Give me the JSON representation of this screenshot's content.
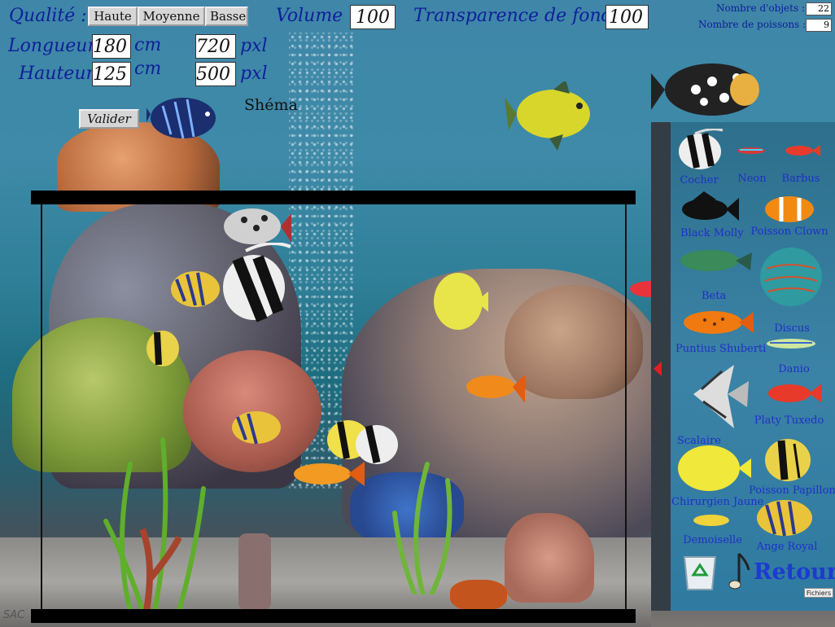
{
  "top": {
    "quality_label": "Qualité :",
    "quality_options": [
      "Haute",
      "Moyenne",
      "Basse"
    ],
    "volume_label": "Volume :",
    "volume_value": "100",
    "transparency_label": "Transparence de fond :",
    "transparency_value": "100",
    "length_label": "Longueur",
    "length_cm": "180",
    "length_unit": "cm",
    "length_px": "720",
    "height_label": "Hauteur",
    "height_cm": "125",
    "height_unit": "cm",
    "height_px": "500",
    "px_unit": "pxl",
    "validate_button": "Valider",
    "schema_label": "Shéma"
  },
  "stats": {
    "objects_label": "Nombre d'objets :",
    "objects_value": "22",
    "fish_label": "Nombre de poissons :",
    "fish_value": "9"
  },
  "palette": {
    "fish": [
      {
        "name": "Cocher",
        "icon": "cocher-fish-icon"
      },
      {
        "name": "Neon",
        "icon": "neon-fish-icon"
      },
      {
        "name": "Barbus",
        "icon": "barbus-fish-icon"
      },
      {
        "name": "Black Molly",
        "icon": "black-molly-fish-icon"
      },
      {
        "name": "Poisson Clown",
        "icon": "clownfish-icon"
      },
      {
        "name": "Beta",
        "icon": "beta-fish-icon"
      },
      {
        "name": "Discus",
        "icon": "discus-fish-icon"
      },
      {
        "name": "Puntius Shuberti",
        "icon": "puntius-fish-icon"
      },
      {
        "name": "Danio",
        "icon": "danio-fish-icon"
      },
      {
        "name": "Scalaire",
        "icon": "scalaire-fish-icon"
      },
      {
        "name": "Platy Tuxedo",
        "icon": "platy-fish-icon"
      },
      {
        "name": "Chirurgien Jaune",
        "icon": "yellow-tang-icon"
      },
      {
        "name": "Poisson Papillon",
        "icon": "butterflyfish-icon"
      },
      {
        "name": "Demoiselle",
        "icon": "demoiselle-fish-icon"
      },
      {
        "name": "Ange Royal",
        "icon": "royal-angelfish-icon"
      }
    ],
    "trash_icon": "recycle-bin-icon",
    "music_icon": "music-note-icon",
    "back_button": "Retour",
    "files_button": "Fichiers"
  },
  "watermark": "SAC"
}
